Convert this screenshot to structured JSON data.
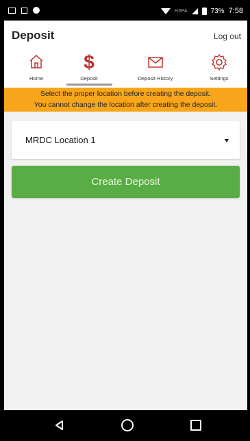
{
  "status_bar": {
    "network": "HSPA",
    "battery": "73%",
    "time": "7:58"
  },
  "app_bar": {
    "title": "Deposit",
    "logout_label": "Log out"
  },
  "tabs": [
    {
      "label": "Home",
      "icon": "home-icon",
      "active": false
    },
    {
      "label": "Deposit",
      "icon": "dollar-icon",
      "active": true
    },
    {
      "label": "Deposit History",
      "icon": "envelope-icon",
      "active": false
    },
    {
      "label": "Settings",
      "icon": "gear-icon",
      "active": false
    }
  ],
  "banner": {
    "line1": "Select the proper location before creating the deposit.",
    "line2": "You cannot change the location after creating the deposit."
  },
  "location_select": {
    "selected": "MRDC Location 1"
  },
  "create_button": {
    "label": "Create Deposit"
  },
  "colors": {
    "accent_red": "#c0322b",
    "banner": "#f7a51b",
    "button_green": "#5aac44"
  }
}
